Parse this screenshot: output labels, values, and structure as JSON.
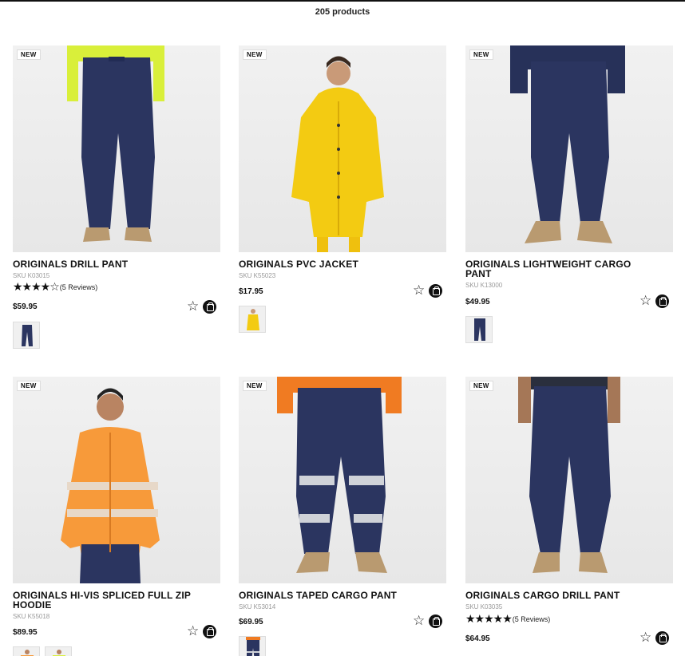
{
  "header": {
    "product_count": "205 products"
  },
  "products": [
    {
      "badge": "NEW",
      "title": "ORIGINALS DRILL PANT",
      "sku": "SKU K03015",
      "rating": {
        "stars": "★★★★☆",
        "reviews": "(5 Reviews)"
      },
      "price": "$59.95",
      "wishlist_icon": "star-outline-icon",
      "cart_icon": "shopping-bag-icon"
    },
    {
      "badge": "NEW",
      "title": "ORIGINALS PVC JACKET",
      "sku": "SKU K55023",
      "price": "$17.95",
      "wishlist_icon": "star-outline-icon",
      "cart_icon": "shopping-bag-icon"
    },
    {
      "badge": "NEW",
      "title": "ORIGINALS LIGHTWEIGHT CARGO PANT",
      "sku": "SKU K13000",
      "price": "$49.95",
      "wishlist_icon": "star-outline-icon",
      "cart_icon": "shopping-bag-icon"
    },
    {
      "badge": "NEW",
      "title": "ORIGINALS HI-VIS SPLICED FULL ZIP HOODIE",
      "sku": "SKU K55018",
      "price": "$89.95",
      "wishlist_icon": "star-outline-icon",
      "cart_icon": "shopping-bag-icon"
    },
    {
      "badge": "NEW",
      "title": "ORIGINALS TAPED CARGO PANT",
      "sku": "SKU K53014",
      "price": "$69.95",
      "wishlist_icon": "star-outline-icon",
      "cart_icon": "shopping-bag-icon"
    },
    {
      "badge": "NEW",
      "title": "ORIGINALS CARGO DRILL PANT",
      "sku": "SKU K03035",
      "rating": {
        "stars": "★★★★★",
        "reviews": "(5 Reviews)"
      },
      "price": "$64.95",
      "wishlist_icon": "star-outline-icon",
      "cart_icon": "shopping-bag-icon"
    }
  ],
  "colors": {
    "navy": "#2b3560",
    "hivis_yellow": "#d9ef3a",
    "pvc_yellow": "#f3cb12",
    "hivis_orange": "#f79a3a",
    "tan_boot": "#b99a70"
  }
}
